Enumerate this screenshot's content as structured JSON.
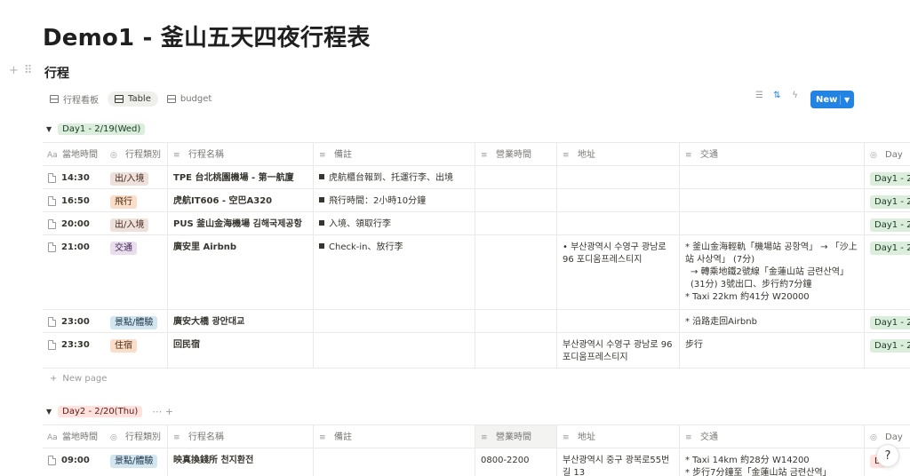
{
  "page": {
    "title": "Demo1 - 釜山五天四夜行程表"
  },
  "database": {
    "title": "行程",
    "views": [
      {
        "label": "行程看板",
        "icon": "board-icon"
      },
      {
        "label": "Table",
        "icon": "table-icon"
      },
      {
        "label": "budget",
        "icon": "table-icon"
      }
    ],
    "new_label": "New"
  },
  "columns": [
    {
      "label": "當地時間",
      "icon": "Aa"
    },
    {
      "label": "行程類別",
      "icon": "◎"
    },
    {
      "label": "行程名稱",
      "icon": "≡"
    },
    {
      "label": "備註",
      "icon": "≡"
    },
    {
      "label": "營業時間",
      "icon": "≡"
    },
    {
      "label": "地址",
      "icon": "≡"
    },
    {
      "label": "交通",
      "icon": "≡"
    },
    {
      "label": "Day",
      "icon": "◎"
    }
  ],
  "groups": [
    {
      "label": "Day1 - 2/19(Wed)",
      "rows": [
        {
          "time": "14:30",
          "category": "出/入境",
          "name": "TPE 台北桃園機場 - 第一航廈",
          "note": "虎航櫃台報到、托運行李、出境",
          "hours": "",
          "address": "",
          "transport": [],
          "day": "Day1 - 2/"
        },
        {
          "time": "16:50",
          "category": "飛行",
          "name": "虎航IT606 - 空巴A320",
          "note": "飛行時間：2小時10分鐘",
          "hours": "",
          "address": "",
          "transport": [],
          "day": "Day1 - 2/"
        },
        {
          "time": "20:00",
          "category": "出/入境",
          "name": "PUS 釜山金海機場 김해국제공항",
          "note": "入境、領取行李",
          "hours": "",
          "address": "",
          "transport": [],
          "day": "Day1 - 2/"
        },
        {
          "time": "21:00",
          "category": "交通",
          "name": "廣安里 Airbnb",
          "note": "Check-in、放行李",
          "hours": "",
          "address": "부산광역시 수영구 광남로 96 포디움프레스티지",
          "transport": [
            "* 釜山金海輕軌「機場站 공항역」 → 「沙上站 사상역」 (7分)",
            "→ 轉乘地鐵2號線「金蓮山站 금련산역」 (31分) 3號出口、步行約7分鐘",
            "* Taxi 22km 約41分 W20000"
          ],
          "day": "Day1 - 2/"
        },
        {
          "time": "23:00",
          "category": "景點/體驗",
          "name": "廣安大橋 광안대교",
          "note": "",
          "hours": "",
          "address": "",
          "transport": [
            "* 沿路走回Airbnb"
          ],
          "day": "Day1 - 2/"
        },
        {
          "time": "23:30",
          "category": "住宿",
          "name": "回民宿",
          "note": "",
          "hours": "",
          "address": "부산광역시 수영구 광남로 96 포디움프레스티지",
          "transport": [
            "步行"
          ],
          "day": "Day1 - 2/"
        }
      ],
      "new_page": "New page"
    },
    {
      "label": "Day2 - 2/20(Thu)",
      "extra": "⋯  +",
      "rows": [
        {
          "time": "09:00",
          "category": "景點/體驗",
          "name": "映真換錢所 천지환전",
          "note": "",
          "hours": "0800-2200",
          "address": "부산광역시 중구 광복로55번길 13",
          "transport": [
            "* Taxi 14km 約28分 W14200",
            "* 步行7分鐘至「金蓮山站 금련산역」"
          ],
          "day": "D"
        }
      ]
    }
  ],
  "colors": {
    "accent": "#2383e2"
  }
}
